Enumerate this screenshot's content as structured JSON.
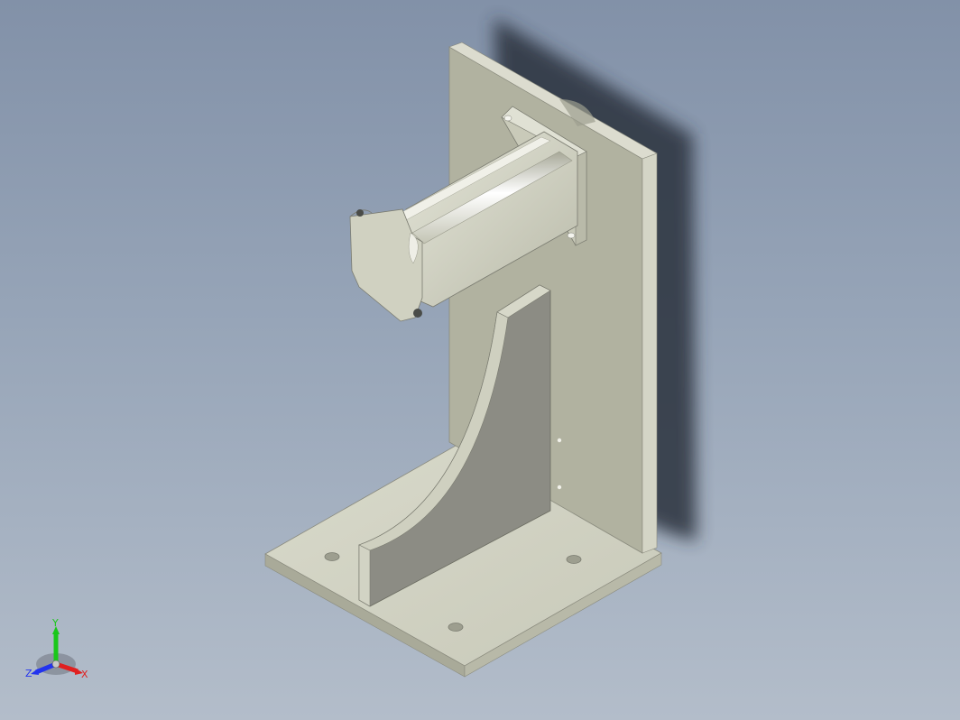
{
  "triad": {
    "y_label": "Y",
    "z_label": "Z",
    "x_label": "X",
    "colors": {
      "y": "#19c719",
      "z": "#2233ee",
      "x": "#e02020"
    }
  },
  "model": {
    "colors": {
      "face_light": "#d6d7c8",
      "face_mid": "#b1b2a0",
      "face_dark": "#8c8c84",
      "edge": "#6a6b60",
      "shadow": "#2c323c"
    }
  }
}
